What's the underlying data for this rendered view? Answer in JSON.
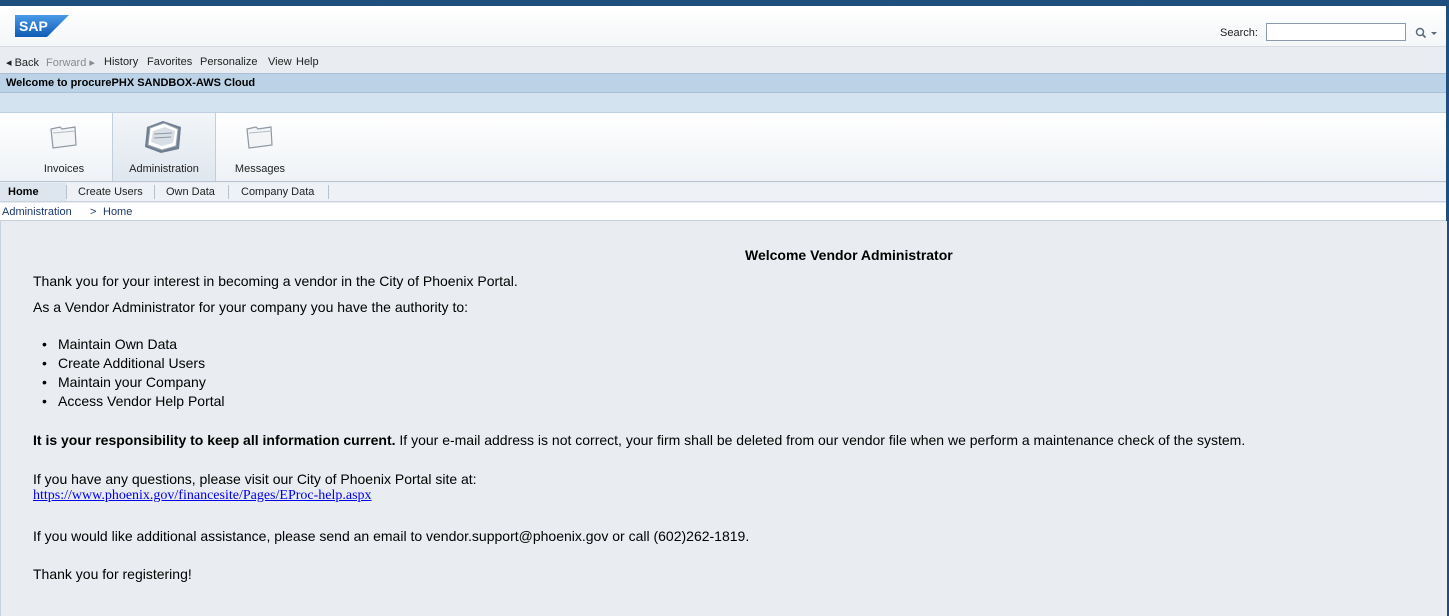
{
  "header": {
    "logo_text": "SAP",
    "search_label": "Search:",
    "search_value": "",
    "search_placeholder": ""
  },
  "menubar": {
    "back": "◂ Back",
    "forward": "Forward ▸",
    "history": "History",
    "favorites": "Favorites",
    "personalize": "Personalize",
    "view": "View",
    "help": "Help"
  },
  "welcome_bar": "Welcome to procurePHX SANDBOX-AWS Cloud",
  "tabs": [
    {
      "label": "Invoices",
      "icon": "folder-icon"
    },
    {
      "label": "Administration",
      "icon": "papers-icon",
      "active": true
    },
    {
      "label": "Messages",
      "icon": "folder-icon"
    }
  ],
  "subnav": {
    "home": "Home",
    "create_users": "Create Users",
    "own_data": "Own Data",
    "company_data": "Company Data"
  },
  "breadcrumb": {
    "parent": "Administration",
    "separator": ">",
    "current": "Home"
  },
  "content": {
    "title": "Welcome Vendor Administrator",
    "intro": "Thank you for your interest in becoming a vendor in the City of Phoenix Portal.",
    "authority": "As a Vendor Administrator for your company you have the authority to:",
    "bullets": [
      "Maintain Own Data",
      "Create Additional Users",
      "Maintain your Company",
      "Access Vendor Help Portal"
    ],
    "responsibility_bold": "It is your responsibility to keep all information current.",
    "responsibility_rest": " If your e-mail address is not correct, your firm shall be deleted from our vendor file when we perform a maintenance check of the system.",
    "questions": "If you have any questions, please visit our City of Phoenix Portal site at:",
    "link": "https://www.phoenix.gov/financesite/Pages/EProc-help.aspx",
    "assistance": "If you would like additional assistance, please send an email to vendor.support@phoenix.gov or call (602)262-1819.",
    "thanks": "Thank you for registering!"
  },
  "colors": {
    "frame": "#1f4f7f",
    "welcome_bar": "#bcd2e6",
    "content_bg": "#e9edf1",
    "link": "#0000ee",
    "logo_blue": "#1a6cc8"
  }
}
